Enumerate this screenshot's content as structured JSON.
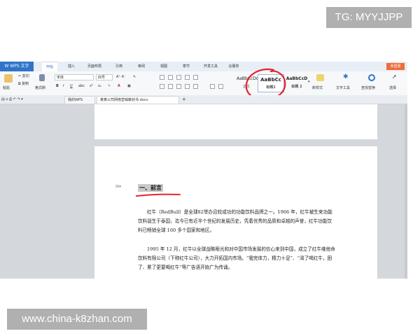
{
  "watermark_top": "TG: MYYJJPP",
  "watermark_bottom": "www.china-k8zhan.com",
  "menubar": {
    "app_button": "W WPS 文字",
    "tabs": [
      "开始",
      "插入",
      "页面布局",
      "引用",
      "审阅",
      "视图",
      "章节",
      "开发工具",
      "云服务"
    ],
    "active_tab": "开始",
    "login": "未登录"
  },
  "ribbon": {
    "paste": "粘贴",
    "cut": "剪切",
    "copy": "复制",
    "format_painter": "格式刷",
    "font_name": "宋体",
    "font_size": "四号",
    "styles": [
      {
        "sample": "AaBbCcDd",
        "label": "正文"
      },
      {
        "sample": "AaBbCc",
        "label": "标题1"
      },
      {
        "sample": "AaBbCcD",
        "label": "标题 2"
      }
    ],
    "new_style": "新样式",
    "text_tools": "文字工具",
    "find_replace": "查找替换",
    "select": "选择"
  },
  "doc_tabs": {
    "tab1": "我的WPS",
    "tab2": "某某公司网络营销策划书.docx"
  },
  "document": {
    "heading": "一、前言",
    "paragraphs": [
      "红牛（RedBull）是全球82举办且较成功的功能饮料品牌之一。1966 年，红牛被生来功能饮料诞生于泰国，迄今已有近半个世纪的发展历史，凭着优秀的品质和卓越的声誉，红牛功能饮料已畅销全球 160 多个国家和地区。",
      "1995 年 12 月，红牛以全球战略眼光和对中国市场发展的信心来到中国，成立了红牛维他命饮料有限公司（下称红牛公司），大力开拓国内市场。“我完体力，精力十足”、“渴了喝红牛，困了、累了更要喝红牛”等广告语开始广为传诵。"
    ]
  },
  "colors": {
    "accent_blue": "#2f74c8",
    "annotation_red": "#e8222c",
    "login_orange": "#ef6c3b"
  }
}
